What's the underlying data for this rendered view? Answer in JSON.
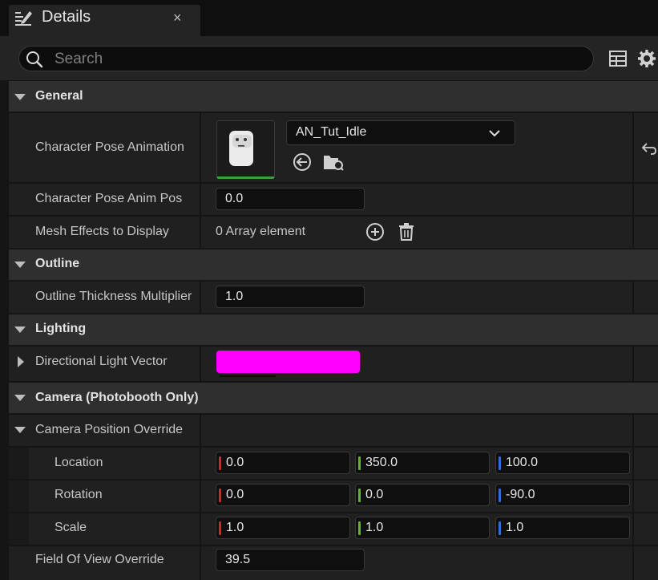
{
  "tab": {
    "title": "Details",
    "close": "×",
    "icon": "pencil-list-icon"
  },
  "search": {
    "placeholder": "Search",
    "value": ""
  },
  "categories": {
    "general": "General",
    "outline": "Outline",
    "lighting": "Lighting",
    "camera": "Camera (Photobooth Only)"
  },
  "properties": {
    "pose_anim": {
      "label": "Character Pose Animation",
      "asset": "AN_Tut_Idle"
    },
    "pose_anim_pos": {
      "label": "Character Pose Anim Pos",
      "value": "0.0"
    },
    "mesh_effects": {
      "label": "Mesh Effects to Display",
      "value": "0 Array element"
    },
    "outline_thickness": {
      "label": "Outline Thickness Multiplier",
      "value": "1.0"
    },
    "light_vector": {
      "label": "Directional Light Vector",
      "color": "#ff00ff"
    },
    "camera_override": {
      "label": "Camera Position Override"
    },
    "location": {
      "label": "Location",
      "x": "0.0",
      "y": "350.0",
      "z": "100.0"
    },
    "rotation": {
      "label": "Rotation",
      "x": "0.0",
      "y": "0.0",
      "z": "-90.0"
    },
    "scale": {
      "label": "Scale",
      "x": "1.0",
      "y": "1.0",
      "z": "1.0"
    },
    "fov": {
      "label": "Field Of View Override",
      "value": "39.5"
    }
  },
  "colors": {
    "x_axis": "#d02828",
    "y_axis": "#6bb12a",
    "z_axis": "#2f6fd6",
    "light": "#ff00ff"
  }
}
